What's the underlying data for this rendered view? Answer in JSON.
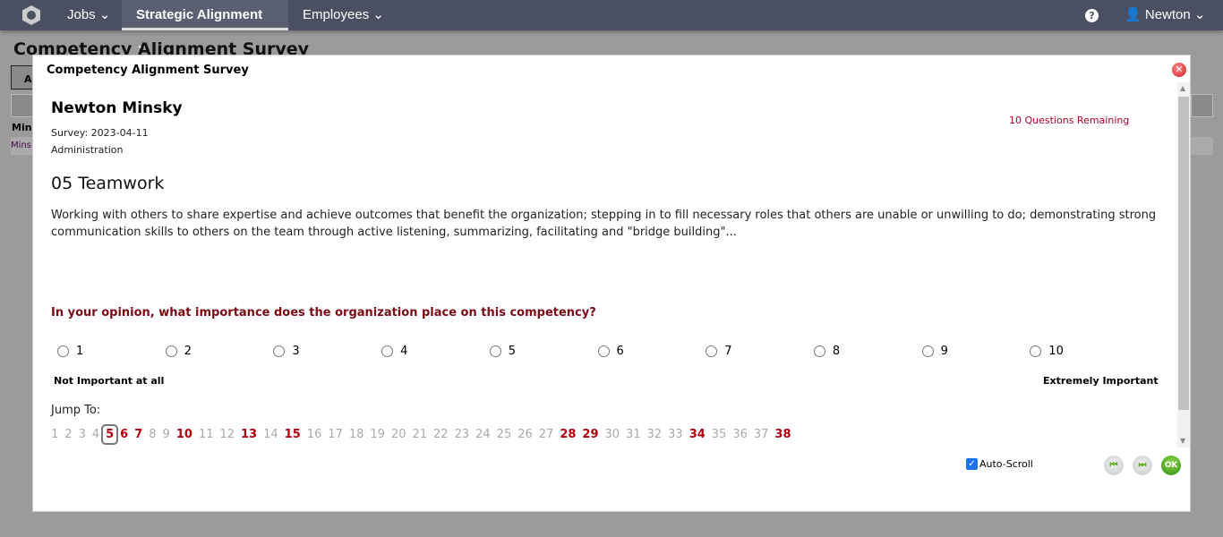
{
  "nav": {
    "items": [
      {
        "label": "Jobs ⌄"
      },
      {
        "label": "Strategic Alignment ⌄"
      },
      {
        "label": "Employees ⌄"
      }
    ],
    "user": "Newton ⌄",
    "help": "?"
  },
  "background": {
    "title": "Competency Alignment Survey",
    "cell1": "A",
    "cell2": "Min",
    "cell3": "Mins"
  },
  "modal": {
    "title": "Competency Alignment Survey",
    "employee": "Newton Minsky",
    "survey": "Survey: 2023-04-11",
    "department": "Administration",
    "remaining": "10 Questions Remaining",
    "competency": "05 Teamwork",
    "description": "Working with others to share expertise and achieve outcomes that benefit the organization; stepping in to fill necessary roles that others are unable or unwilling to do; demonstrating strong communication skills to others on the team through active listening, summarizing, facilitating and \"bridge building\"...",
    "question": "In your opinion, what importance does the organization place on this competency?",
    "options": [
      "1",
      "2",
      "3",
      "4",
      "5",
      "6",
      "7",
      "8",
      "9",
      "10"
    ],
    "selected": null,
    "low_label": "Not Important at all",
    "high_label": "Extremely Important",
    "jump_label": "Jump To:",
    "jump": [
      {
        "n": "1",
        "s": "done"
      },
      {
        "n": "2",
        "s": "done"
      },
      {
        "n": "3",
        "s": "done"
      },
      {
        "n": "4",
        "s": "done"
      },
      {
        "n": "5",
        "s": "current"
      },
      {
        "n": "6",
        "s": "pending"
      },
      {
        "n": "7",
        "s": "pending"
      },
      {
        "n": "8",
        "s": "done"
      },
      {
        "n": "9",
        "s": "done"
      },
      {
        "n": "10",
        "s": "pending"
      },
      {
        "n": "11",
        "s": "done"
      },
      {
        "n": "12",
        "s": "done"
      },
      {
        "n": "13",
        "s": "pending"
      },
      {
        "n": "14",
        "s": "done"
      },
      {
        "n": "15",
        "s": "pending"
      },
      {
        "n": "16",
        "s": "done"
      },
      {
        "n": "17",
        "s": "done"
      },
      {
        "n": "18",
        "s": "done"
      },
      {
        "n": "19",
        "s": "done"
      },
      {
        "n": "20",
        "s": "done"
      },
      {
        "n": "21",
        "s": "done"
      },
      {
        "n": "22",
        "s": "done"
      },
      {
        "n": "23",
        "s": "done"
      },
      {
        "n": "24",
        "s": "done"
      },
      {
        "n": "25",
        "s": "done"
      },
      {
        "n": "26",
        "s": "done"
      },
      {
        "n": "27",
        "s": "done"
      },
      {
        "n": "28",
        "s": "pending"
      },
      {
        "n": "29",
        "s": "pending"
      },
      {
        "n": "30",
        "s": "done"
      },
      {
        "n": "31",
        "s": "done"
      },
      {
        "n": "32",
        "s": "done"
      },
      {
        "n": "33",
        "s": "done"
      },
      {
        "n": "34",
        "s": "pending"
      },
      {
        "n": "35",
        "s": "done"
      },
      {
        "n": "36",
        "s": "done"
      },
      {
        "n": "37",
        "s": "done"
      },
      {
        "n": "38",
        "s": "pending"
      }
    ],
    "auto_scroll_label": "Auto-Scroll",
    "auto_scroll": true,
    "ok_label": "OK",
    "colors": {
      "pending": "#b00010",
      "done": "#a9a9a9",
      "nav": "#4a5062"
    }
  }
}
